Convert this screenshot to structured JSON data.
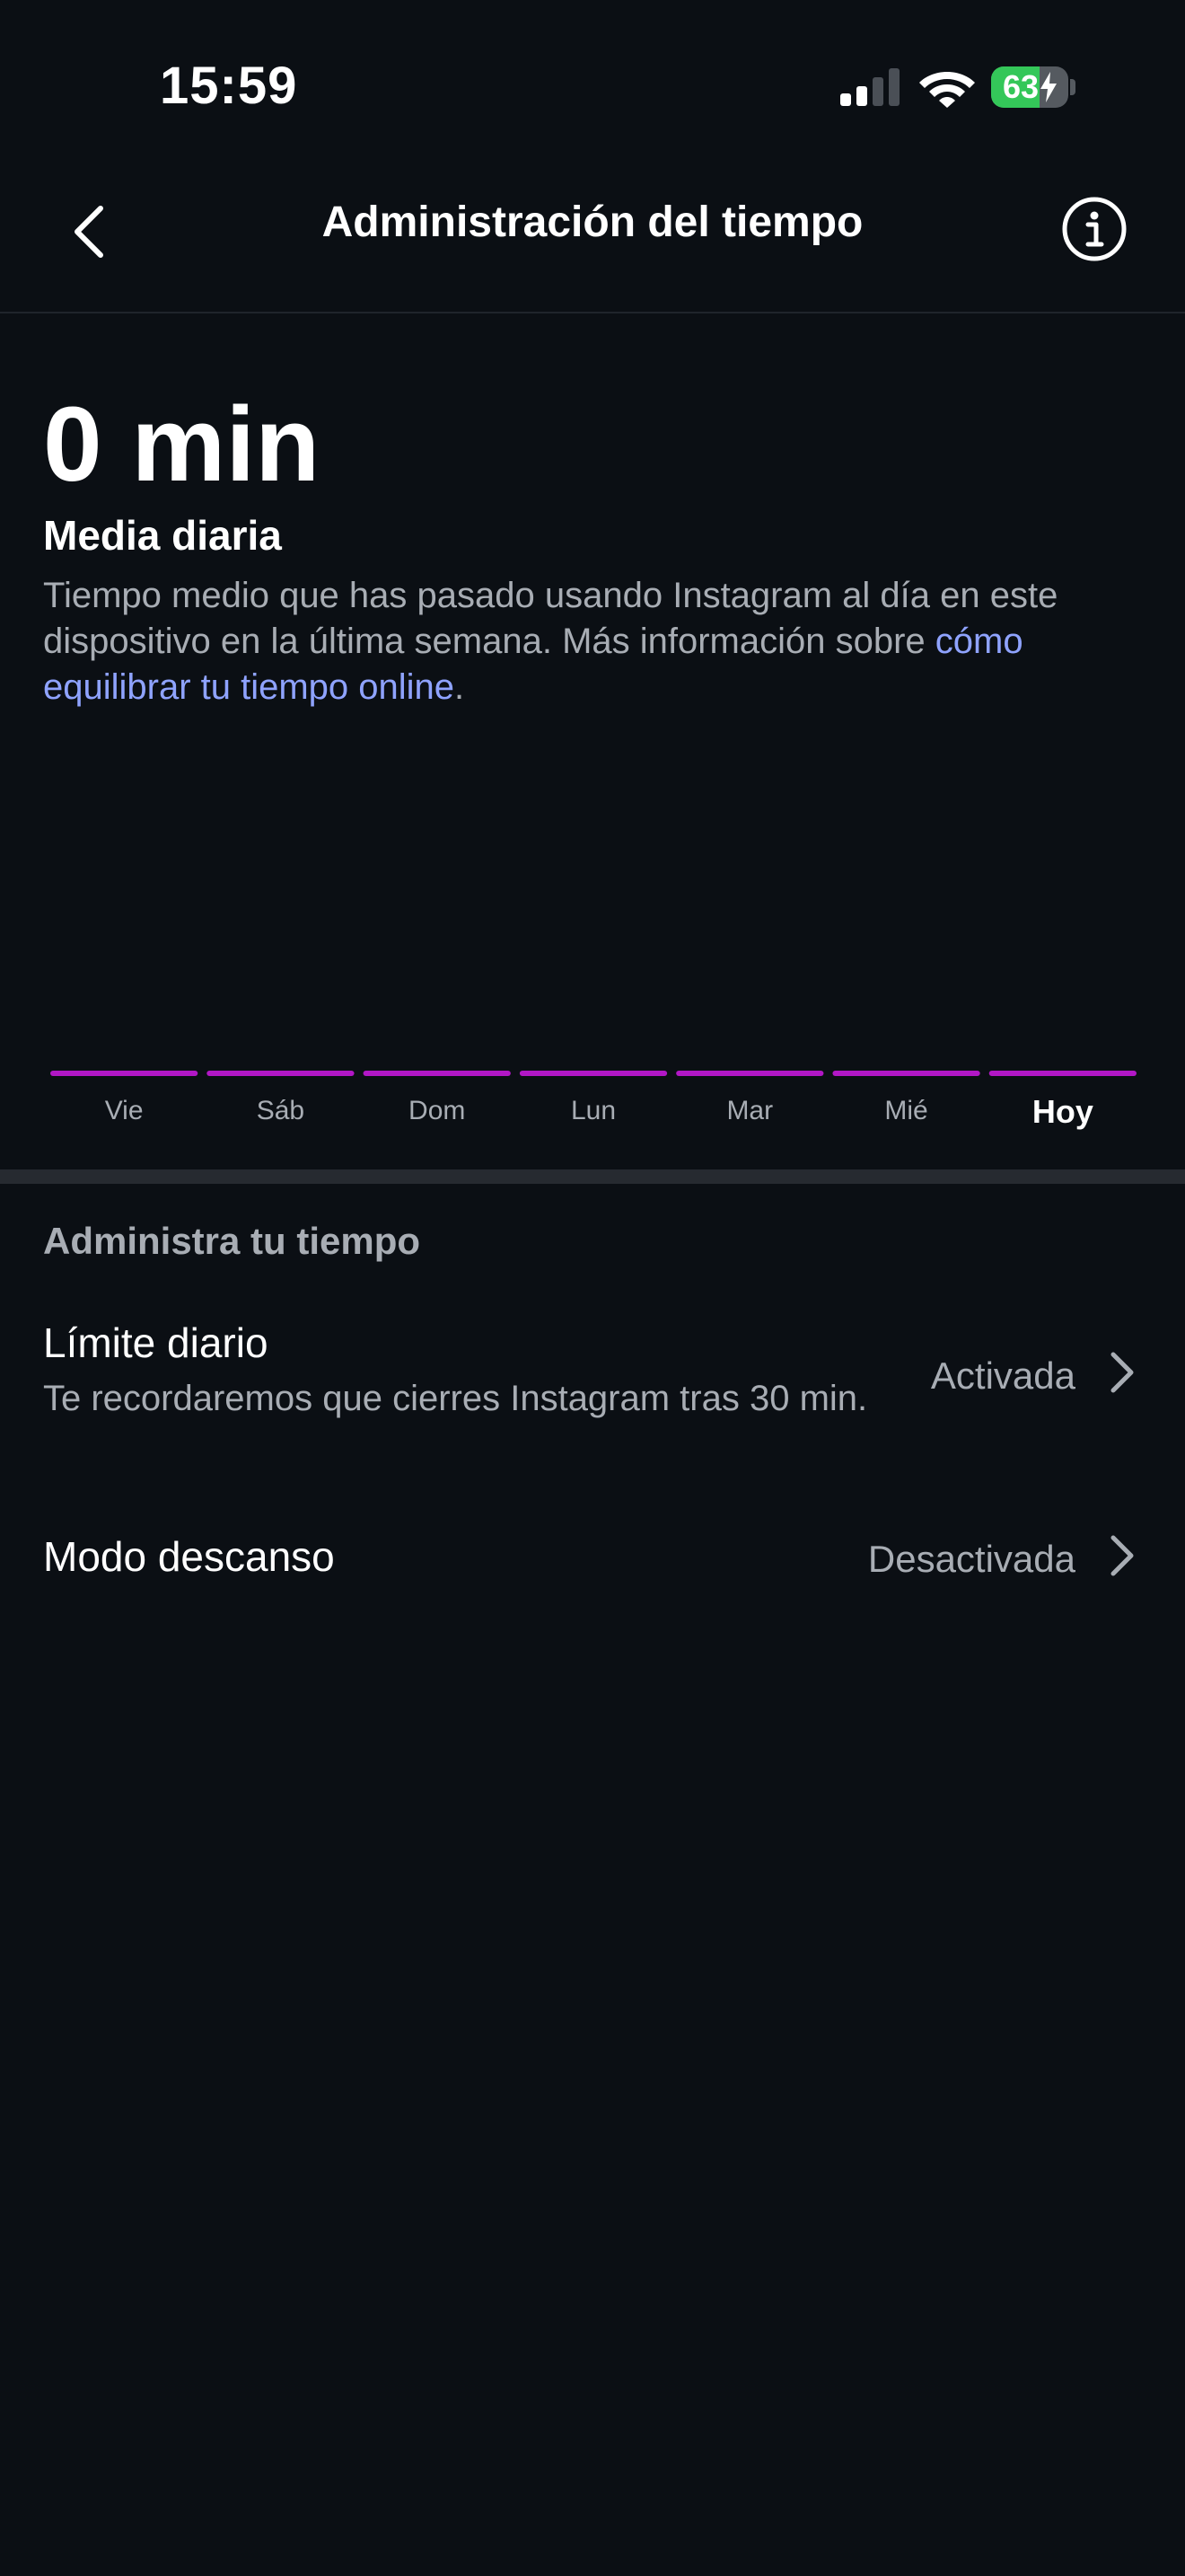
{
  "status_bar": {
    "time": "15:59",
    "battery_level": "63",
    "battery_fraction": 0.63,
    "signal_bars_active": 2,
    "signal_bars_total": 4
  },
  "header": {
    "title": "Administración del tiempo",
    "back_icon": "chevron-left-icon",
    "info_icon": "info-circle-icon"
  },
  "summary": {
    "value": "0 min",
    "label": "Media diaria",
    "description": "Tiempo medio que has pasado usando Instagram al día en este dispositivo en la última semana. Más información sobre ",
    "link_text": "cómo equilibrar tu tiempo online",
    "description_end": "."
  },
  "chart_data": {
    "type": "bar",
    "categories": [
      "Vie",
      "Sáb",
      "Dom",
      "Lun",
      "Mar",
      "Mié",
      "Hoy"
    ],
    "values": [
      0,
      0,
      0,
      0,
      0,
      0,
      0
    ],
    "highlighted_category": "Hoy",
    "bar_color": "#b217c6"
  },
  "manage": {
    "section_title": "Administra tu tiempo",
    "daily_limit": {
      "title": "Límite diario",
      "subtitle": "Te recordaremos que cierres Instagram tras 30 min.",
      "value": "Activada"
    },
    "sleep_mode": {
      "title": "Modo descanso",
      "value": "Desactivada"
    }
  },
  "colors": {
    "background": "#0b0f14",
    "link": "#8fa3ff",
    "secondary_text": "#a8adb4",
    "battery_green": "#34c759"
  }
}
